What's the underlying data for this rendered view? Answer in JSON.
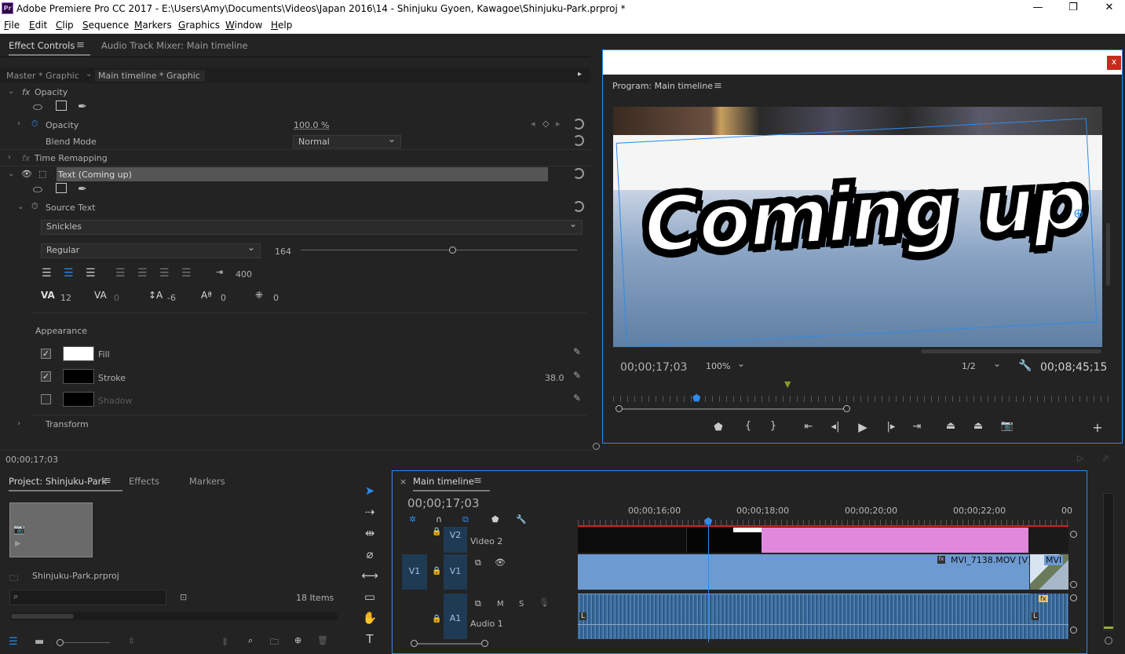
{
  "app": {
    "title": "Adobe Premiere Pro CC 2017 - E:\\Users\\Amy\\Documents\\Videos\\Japan 2016\\14 - Shinjuku Gyoen, Kawagoe\\Shinjuku-Park.prproj *",
    "logo": "Pr"
  },
  "menu": [
    "File",
    "Edit",
    "Clip",
    "Sequence",
    "Markers",
    "Graphics",
    "Window",
    "Help"
  ],
  "menu_underline": [
    "F",
    "E",
    "C",
    "S",
    "M",
    "G",
    "W",
    "H"
  ],
  "effect_panel": {
    "tab_effect_controls": "Effect Controls",
    "tab_audio_mixer": "Audio Track Mixer: Main timeline",
    "source_master": "Master * Graphic",
    "source_sequence": "Main timeline * Graphic",
    "opacity_header": "Opacity",
    "opacity_label": "Opacity",
    "opacity_value": "100.0 %",
    "blend_mode_label": "Blend Mode",
    "blend_mode_value": "Normal",
    "time_remap_label": "Time Remapping",
    "text_layer_label": "Text (Coming up)",
    "source_text_label": "Source Text",
    "font_value": "Snickles",
    "font_style_value": "Regular",
    "font_size": "164",
    "font_size_slider": 0.55,
    "tracking_box": "400",
    "kerning": "12",
    "tracking": "0",
    "leading": "-6",
    "baseline": "0",
    "tsume": "0",
    "appearance_label": "Appearance",
    "fill_label": "Fill",
    "fill_color": "#ffffff",
    "stroke_label": "Stroke",
    "stroke_value": "38.0",
    "stroke_color": "#000000",
    "shadow_label": "Shadow",
    "shadow_color": "#000000",
    "transform_label": "Transform",
    "timecode": "00;00;17;03"
  },
  "program": {
    "title": "Program: Main timeline",
    "overlay_text": "Coming up",
    "timecode": "00;00;17;03",
    "zoom": "100%",
    "resolution": "1/2",
    "duration": "00;08;45;15",
    "close_glyph": "x"
  },
  "project": {
    "tab_project": "Project: Shinjuku-Park",
    "tab_effects": "Effects",
    "tab_markers": "Markers",
    "filename": "Shinjuku-Park.prproj",
    "item_count": "18 Items",
    "search_placeholder": ""
  },
  "timeline": {
    "tab_label": "Main timeline",
    "timecode": "00;00;17;03",
    "ruler": [
      "00;00;16;00",
      "00;00;18;00",
      "00;00;20;00",
      "00;00;22;00",
      "00"
    ],
    "v2_label": "V2",
    "v2_name": "Video 2",
    "v1_source": "V1",
    "v1_label": "V1",
    "a1_label": "A1",
    "a1_name": "Audio 1",
    "m_label": "M",
    "s_label": "S",
    "clip1_name": "MVI_7138.MOV [V]",
    "clip2_name": "MVI",
    "fx_badge": "fx",
    "audio_L": "L"
  },
  "colors": {
    "accent_blue": "#2d8ceb",
    "graphic_clip": "#e088dc",
    "video_clip": "#6d9bd1",
    "audio_clip": "#3c6c9c"
  }
}
